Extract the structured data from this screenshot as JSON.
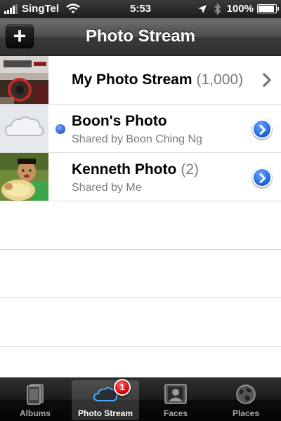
{
  "status_bar": {
    "carrier": "SingTel",
    "time": "5:53",
    "battery": "100%",
    "battery_level": 1.0,
    "signal_bars": 4
  },
  "nav_bar": {
    "title": "Photo Stream",
    "add_label": "+"
  },
  "streams": [
    {
      "title": "My Photo Stream",
      "count": "(1,000)",
      "subtitle": "",
      "thumb": "mixed-photos",
      "accessory": "chevron-right-icon",
      "unread": false
    },
    {
      "title": "Boon's Photo",
      "count": "",
      "subtitle": "Shared by Boon Ching Ng",
      "thumb": "cloud-icon",
      "accessory": "detail-disclosure-icon",
      "unread": true
    },
    {
      "title": "Kenneth Photo",
      "count": "(2)",
      "subtitle": "Shared by Me",
      "thumb": "boy-photo",
      "accessory": "detail-disclosure-icon",
      "unread": false
    }
  ],
  "tab_bar": {
    "tabs": [
      {
        "label": "Albums",
        "icon": "albums-icon",
        "active": false
      },
      {
        "label": "Photo Stream",
        "icon": "cloud-icon",
        "active": true,
        "badge": "1"
      },
      {
        "label": "Faces",
        "icon": "faces-icon",
        "active": false
      },
      {
        "label": "Places",
        "icon": "globe-icon",
        "active": false
      }
    ]
  },
  "colors": {
    "accent": "#1b5fd6",
    "badge": "#c80000",
    "secondary_text": "#7a7a7a"
  }
}
